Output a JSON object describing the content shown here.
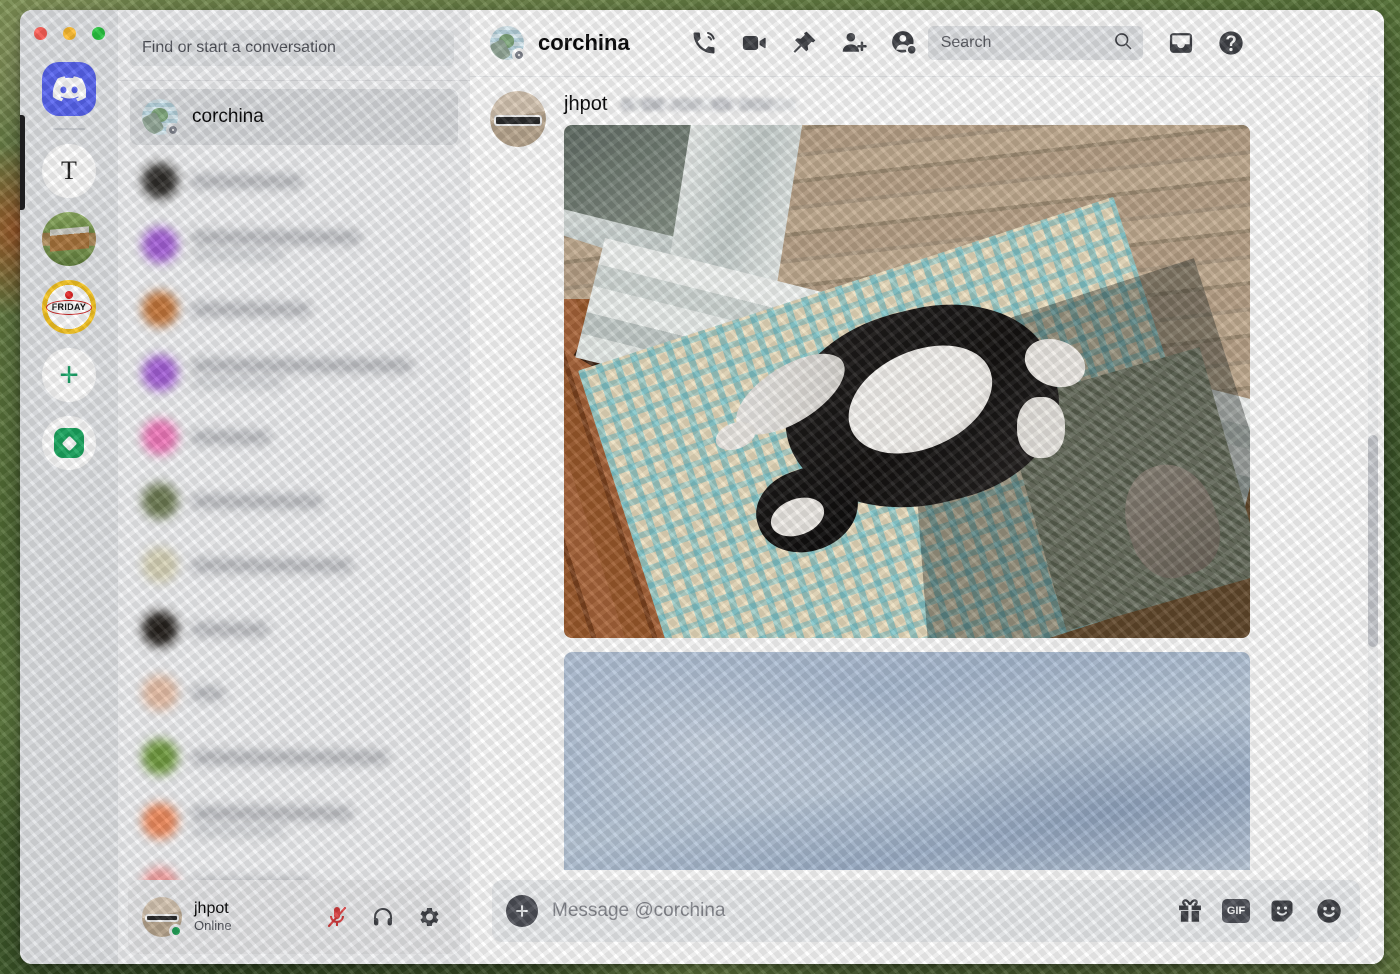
{
  "window": {
    "traffic_lights": [
      "close",
      "minimize",
      "zoom"
    ],
    "colors": {
      "close": "#ff5f57",
      "minimize": "#febc2e",
      "zoom": "#28c840"
    }
  },
  "server_rail": {
    "items": [
      {
        "name": "discord-home",
        "label": "Direct Messages",
        "type": "discord-logo"
      },
      {
        "name": "server-t",
        "label": "T",
        "type": "letter"
      },
      {
        "name": "server-cabin",
        "label": "",
        "type": "photo-cabin"
      },
      {
        "name": "server-friday",
        "label": "FRIDAY",
        "type": "photo-friday"
      },
      {
        "name": "add-server",
        "label": "+",
        "type": "plus"
      },
      {
        "name": "explore-servers",
        "label": "",
        "type": "explore"
      }
    ]
  },
  "sidebar": {
    "search": {
      "placeholder": "Find or start a conversation",
      "value": ""
    },
    "dms": [
      {
        "name": "corchina",
        "status": "offline",
        "active": true,
        "redacted": false,
        "avatar_color": "#b6d3de"
      },
      {
        "name": "",
        "status": "offline",
        "active": false,
        "redacted": true,
        "avatar_color": "#2f2d2a",
        "name_w": 110,
        "has_sub": false
      },
      {
        "name": "",
        "status": "offline",
        "active": false,
        "redacted": true,
        "avatar_color": "#a55fd8",
        "name_w": 168,
        "has_sub": true,
        "sub_w": 92
      },
      {
        "name": "",
        "status": "offline",
        "active": false,
        "redacted": true,
        "avatar_color": "#c4763a",
        "name_w": 118,
        "has_sub": false
      },
      {
        "name": "",
        "status": "offline",
        "active": false,
        "redacted": true,
        "avatar_color": "#a55fd8",
        "name_w": 220,
        "has_sub": true,
        "sub_w": 92
      },
      {
        "name": "",
        "status": "offline",
        "active": false,
        "redacted": true,
        "avatar_color": "#f178bb",
        "name_w": 78,
        "has_sub": false
      },
      {
        "name": "",
        "status": "offline",
        "active": false,
        "redacted": true,
        "avatar_color": "#6c7a52",
        "name_w": 130,
        "has_sub": false
      },
      {
        "name": "",
        "status": "offline",
        "active": false,
        "redacted": true,
        "avatar_color": "#d8d4b8",
        "name_w": 160,
        "has_sub": false
      },
      {
        "name": "",
        "status": "offline",
        "active": false,
        "redacted": true,
        "avatar_color": "#24201c",
        "name_w": 76,
        "has_sub": false
      },
      {
        "name": "",
        "status": "offline",
        "active": false,
        "redacted": true,
        "avatar_color": "#e8c0a8",
        "name_w": 32,
        "has_sub": false
      },
      {
        "name": "",
        "status": "offline",
        "active": false,
        "redacted": true,
        "avatar_color": "#6f9a3e",
        "name_w": 196,
        "has_sub": false
      },
      {
        "name": "",
        "status": "offline",
        "active": false,
        "redacted": true,
        "avatar_color": "#ef8a5c",
        "name_w": 160,
        "has_sub": true,
        "sub_w": 92
      },
      {
        "name": "",
        "status": "offline",
        "active": false,
        "redacted": true,
        "avatar_color": "#f4a0a0",
        "name_w": 120,
        "has_sub": false
      }
    ]
  },
  "user_panel": {
    "username": "jhpot",
    "status": "Online",
    "status_color": "#23a55a",
    "buttons": [
      {
        "name": "mute-microphone-button",
        "icon": "microphone-muted-icon",
        "active": true,
        "color": "#d83c3e"
      },
      {
        "name": "deafen-button",
        "icon": "headphones-icon",
        "active": false,
        "color": "#4e5058"
      },
      {
        "name": "user-settings-button",
        "icon": "gear-icon",
        "active": false,
        "color": "#4e5058"
      }
    ]
  },
  "chat_header": {
    "title": "corchina",
    "actions": [
      {
        "name": "start-voice-call-button",
        "icon": "phone-call-icon"
      },
      {
        "name": "start-video-call-button",
        "icon": "video-camera-icon"
      },
      {
        "name": "pinned-messages-button",
        "icon": "pin-icon"
      },
      {
        "name": "add-friends-to-dm-button",
        "icon": "add-person-icon"
      },
      {
        "name": "user-profile-button",
        "icon": "user-profile-icon"
      }
    ],
    "search": {
      "placeholder": "Search",
      "value": "",
      "icon": "search-icon"
    },
    "right_actions": [
      {
        "name": "inbox-button",
        "icon": "inbox-tray-icon"
      },
      {
        "name": "help-button",
        "icon": "help-question-icon"
      }
    ]
  },
  "messages": [
    {
      "author": "jhpot",
      "timestamp": "",
      "timestamp_redacted": true,
      "attachments": [
        {
          "name": "cat-on-rug-photo",
          "alt": "Tuxedo cat lying on its back on a blue and cream patterned rug by a sliding glass door with a wooden deck outside"
        },
        {
          "name": "sky-photo",
          "alt": "Blue-grey sky photograph, partially cropped by the viewport"
        }
      ]
    }
  ],
  "composer": {
    "placeholder": "Message @corchina",
    "value": "",
    "add_button": {
      "name": "upload-attachment-button",
      "icon": "plus-icon"
    },
    "actions": [
      {
        "name": "gift-button",
        "icon": "gift-icon",
        "label": ""
      },
      {
        "name": "gif-picker-button",
        "icon": "gif-icon",
        "label": "GIF"
      },
      {
        "name": "sticker-picker-button",
        "icon": "sticker-icon",
        "label": ""
      },
      {
        "name": "emoji-picker-button",
        "icon": "emoji-smile-icon",
        "label": ""
      }
    ]
  },
  "scrollbar": {
    "name": "chat-scrollbar",
    "position_pct": 62
  },
  "theme": {
    "accent": "#5865f2",
    "sidebar_bg": "#f2f3f5",
    "rail_bg": "#e3e5e8",
    "chat_bg": "#ffffff",
    "text_primary": "#060607",
    "text_muted": "#4e5058",
    "online_green": "#23a55a",
    "mute_red": "#d83c3e"
  }
}
